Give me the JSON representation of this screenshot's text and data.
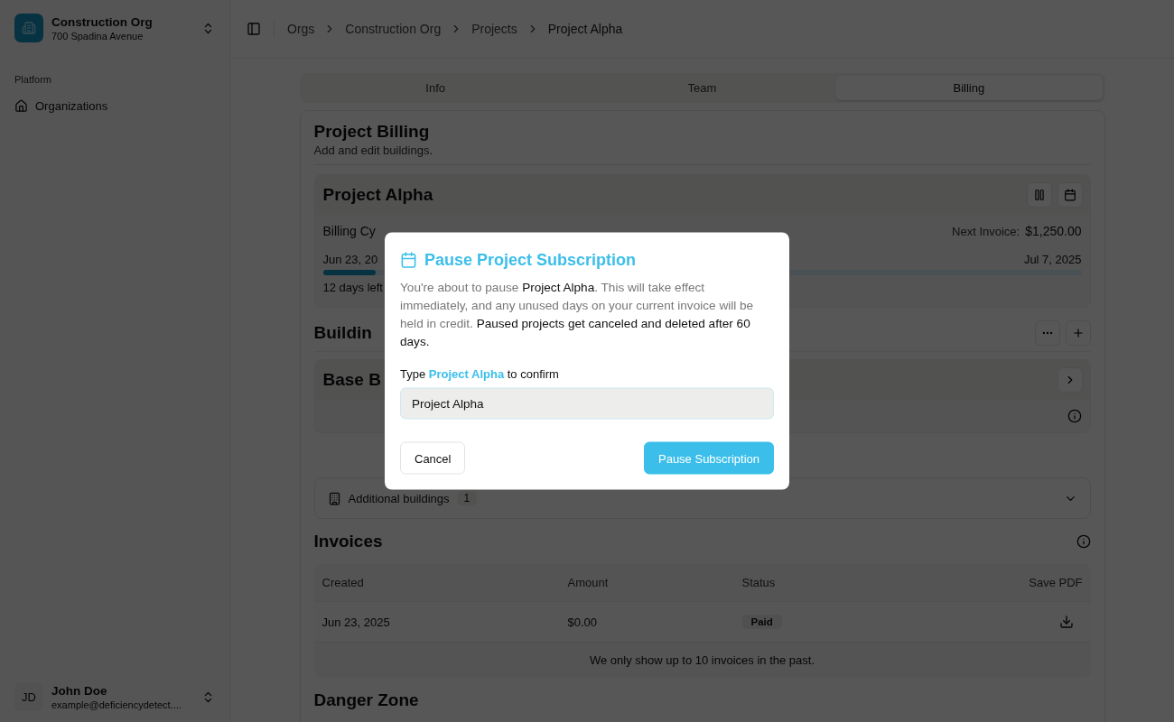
{
  "sidebar": {
    "org": {
      "name": "Construction Org",
      "address": "700 Spadina Avenue"
    },
    "group_label": "Platform",
    "items": [
      {
        "label": "Organizations"
      }
    ],
    "user": {
      "initials": "JD",
      "name": "John Doe",
      "email": "example@deficiencydetect...."
    }
  },
  "breadcrumbs": [
    "Orgs",
    "Construction Org",
    "Projects",
    "Project Alpha"
  ],
  "tabs": [
    {
      "label": "Info",
      "selected": false
    },
    {
      "label": "Team",
      "selected": false
    },
    {
      "label": "Billing",
      "selected": true
    }
  ],
  "billing": {
    "title": "Project Billing",
    "subtitle": "Add and edit buildings.",
    "project": {
      "name": "Project Alpha",
      "cycle": "Billing Cy",
      "next_invoice_label": "Next Invoice:",
      "next_invoice": "$1,250.00",
      "start": "Jun 23, 20",
      "end": "Jul 7, 2025",
      "level": 0.07,
      "remaining": "12 days left"
    },
    "buildings": {
      "title": "Buildin",
      "base": "Base B",
      "additional": {
        "label": "Additional buildings",
        "count": "1"
      }
    },
    "invoices": {
      "title": "Invoices",
      "columns": [
        "Created",
        "Amount",
        "Status",
        "Save PDF"
      ],
      "rows": [
        {
          "created": "Jun 23, 2025",
          "amount": "$0.00",
          "status": "Paid"
        }
      ],
      "note": "We only show up to 10 invoices in the past."
    },
    "danger_title": "Danger Zone"
  },
  "dialog": {
    "title": "Pause Project Subscription",
    "body": [
      {
        "text": "You're about to pause ",
        "strong": false
      },
      {
        "text": "Project Alpha",
        "strong": true
      },
      {
        "text": ". This will take effect immediately, and any unused days on your current invoice will be held in credit. ",
        "strong": false
      },
      {
        "text": "Paused projects get canceled and deleted after 60 days.",
        "strong": true
      }
    ],
    "confirm_label": [
      {
        "text": "Type ",
        "strong": false
      },
      {
        "text": "Project Alpha",
        "strong": true
      },
      {
        "text": " to confirm",
        "strong": false
      }
    ],
    "input_value": "Project Alpha",
    "cancel": "Cancel",
    "submit": "Pause Subscription"
  }
}
